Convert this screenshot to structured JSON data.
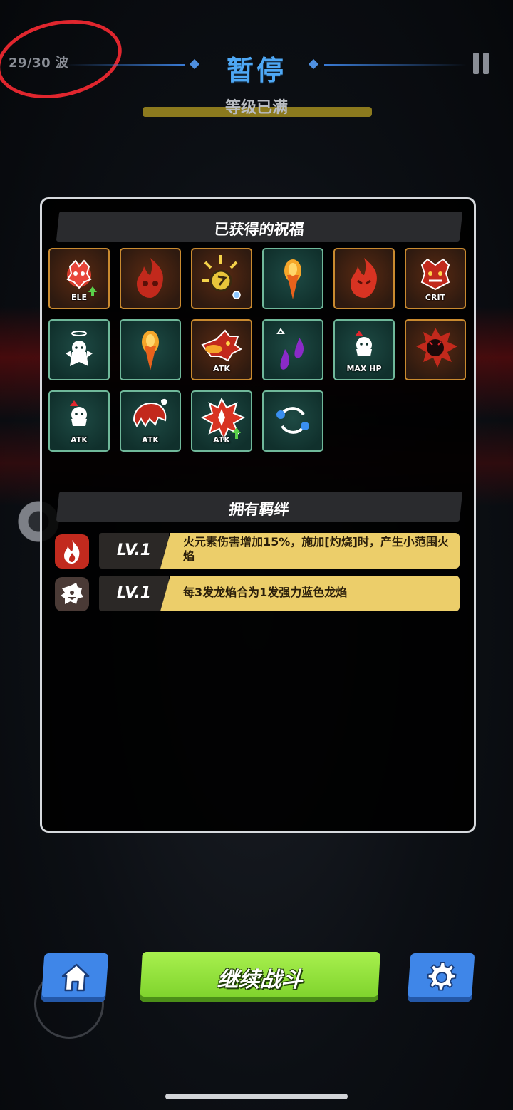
{
  "header": {
    "wave": "29/30 波",
    "title": "暂停",
    "level_status": "等级已满"
  },
  "blessings": {
    "title": "已获得的祝福",
    "tiles": [
      {
        "icon": "ele-up-demon-icon",
        "label": "ELE",
        "frame": "orange"
      },
      {
        "icon": "fire-skull-icon",
        "label": "",
        "frame": "orange"
      },
      {
        "icon": "lightning-orb-icon",
        "label": "",
        "frame": "orange"
      },
      {
        "icon": "fireball-icon",
        "label": "",
        "frame": "green"
      },
      {
        "icon": "fire-demon-icon",
        "label": "",
        "frame": "orange"
      },
      {
        "icon": "crit-demon-icon",
        "label": "CRIT",
        "frame": "orange"
      },
      {
        "icon": "angel-ghost-icon",
        "label": "",
        "frame": "green"
      },
      {
        "icon": "fireball-icon",
        "label": "",
        "frame": "green"
      },
      {
        "icon": "atk-up-dragon-icon",
        "label": "ATK",
        "frame": "orange"
      },
      {
        "icon": "purple-flames-icon",
        "label": "",
        "frame": "green"
      },
      {
        "icon": "max-hp-up-icon",
        "label": "MAX HP",
        "frame": "green"
      },
      {
        "icon": "devil-burst-icon",
        "label": "",
        "frame": "orange"
      },
      {
        "icon": "atk-up-ghost-icon",
        "label": "ATK",
        "frame": "green"
      },
      {
        "icon": "atk-chomper-icon",
        "label": "ATK",
        "frame": "green"
      },
      {
        "icon": "atk-burst-up-icon",
        "label": "ATK",
        "frame": "green"
      },
      {
        "icon": "ice-orbit-icon",
        "label": "",
        "frame": "green"
      }
    ]
  },
  "bonds": {
    "title": "拥有羁绊",
    "items": [
      {
        "icon": "fire-element-icon",
        "level": "LV.1",
        "desc": "火元素伤害增加15%，施加[灼烧]时，产生小范围火焰"
      },
      {
        "icon": "dragon-head-icon",
        "level": "LV.1",
        "desc": "每3发龙焰合为1发强力蓝色龙焰"
      }
    ]
  },
  "footer": {
    "continue_label": "继续战斗"
  },
  "colors": {
    "title_blue": "#4ea8f5",
    "button_blue": "#3f86e8",
    "continue_green": "#7cd12a",
    "bond_yellow": "#ecce6a",
    "circle_red": "#e0262e"
  }
}
